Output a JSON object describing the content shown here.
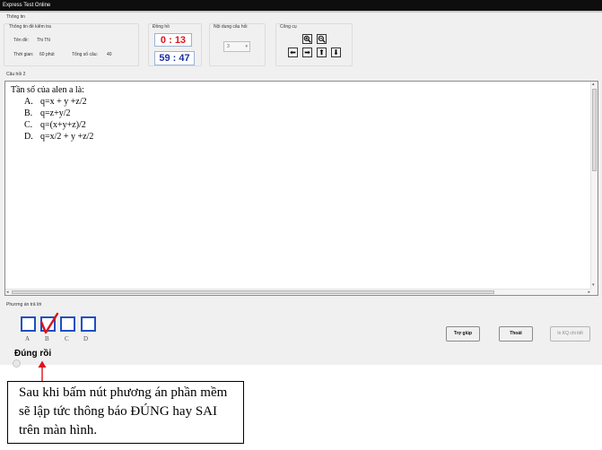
{
  "window": {
    "title": "Express Test Online"
  },
  "info": {
    "section_label": "Thông tin",
    "exam_group_label": "Thông tin đề kiểm tra",
    "exam_name_label": "Tên đề:",
    "exam_name_value": "Thi TN",
    "time_label": "Thời gian:",
    "time_value": "60 phút",
    "total_label": "Tổng số câu:",
    "total_value": "40"
  },
  "clock": {
    "label": "Đồng hồ",
    "elapsed": "0  : 13",
    "remaining": "59 : 47"
  },
  "content": {
    "label": "Nội dung câu hỏi",
    "selected": "3"
  },
  "tools": {
    "label": "Công cụ",
    "icons": [
      "zoom-in-icon",
      "zoom-out-icon",
      "arrow-left-icon",
      "arrow-right-icon",
      "arrow-up-icon",
      "arrow-down-icon"
    ]
  },
  "question": {
    "label": "Câu hỏi 2",
    "text": "Tần số của alen a là:",
    "answers": [
      {
        "key": "A.",
        "text": "q=x + y +z/2"
      },
      {
        "key": "B.",
        "text": "q=z+y/2"
      },
      {
        "key": "C.",
        "text": "q=(x+y+z)/2"
      },
      {
        "key": "D.",
        "text": "q=x/2 + y +z/2"
      }
    ]
  },
  "answer_panel": {
    "label": "Phương án trả lời",
    "choices": [
      "A",
      "B",
      "C",
      "D"
    ],
    "selected": "B",
    "result": "Đúng rồi"
  },
  "buttons": {
    "help": "Trợ giúp",
    "exit": "Thoát",
    "print": "In KQ chi tiết"
  },
  "callout": {
    "text": "Sau khi bấm nút phương án phần mềm sẽ lập tức thông báo ĐÚNG hay SAI trên màn hình."
  },
  "colors": {
    "clock_red": "#e0131b",
    "clock_blue": "#1c32a4",
    "checkmark": "#d9111d",
    "choice_border": "#1c4fc4",
    "arrow": "#e0101b"
  }
}
